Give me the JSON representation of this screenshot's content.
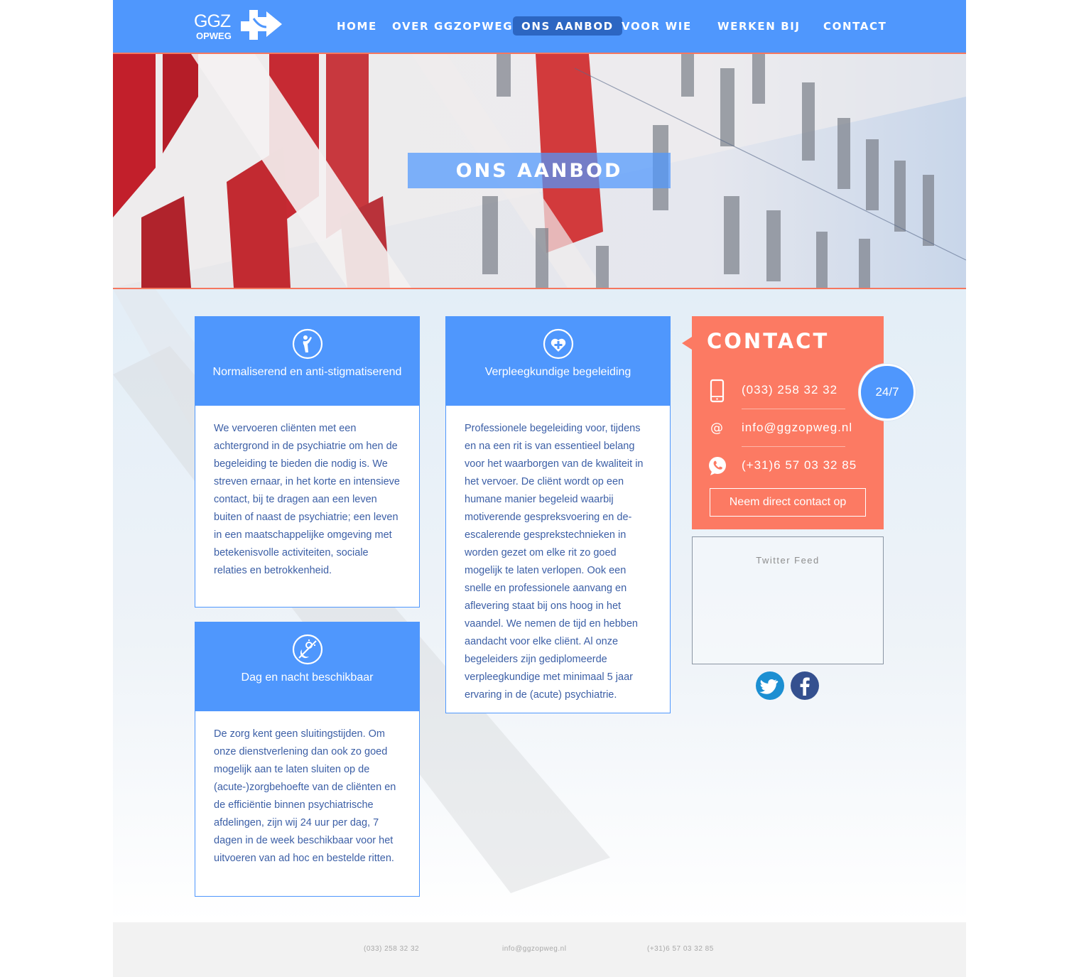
{
  "brand": {
    "logo_top": "GGZ",
    "logo_bottom": "OPWEG",
    "blue": "#4f97fd",
    "coral": "#fc7a63"
  },
  "nav": {
    "items": [
      {
        "label": "HOME",
        "active": false
      },
      {
        "label": "OVER GGZOPWEG",
        "active": false
      },
      {
        "label": "ONS AANBOD",
        "active": true
      },
      {
        "label": "VOOR WIE",
        "active": false
      },
      {
        "label": "WERKEN BIJ",
        "active": false
      },
      {
        "label": "CONTACT",
        "active": false
      }
    ]
  },
  "hero": {
    "title": "ONS AANBOD"
  },
  "cards": [
    {
      "icon": "person-icon",
      "title": "Normaliserend en anti-stigmatiserend",
      "body": "We vervoeren cliënten met een achtergrond in de psychiatrie om hen de begeleiding te bieden die nodig is. We streven ernaar, in het korte en intensieve contact, bij te dragen aan een leven buiten of naast de psychiatrie; een leven in een maatschappelijke omgeving met betekenisvolle activiteiten, sociale relaties en betrokkenheid."
    },
    {
      "icon": "heart-plus-icon",
      "title": "Verpleegkundige begeleiding",
      "body": "Professionele begeleiding voor, tijdens en na een rit is van essentieel belang voor het waarborgen van de kwaliteit in het vervoer. De cliënt wordt op een humane manier begeleid waarbij motiverende gespreksvoering en de-escalerende gesprekstechnieken in worden gezet om elke rit zo goed mogelijk te laten verlopen. Ook een snelle en professionele aanvang en aflevering staat bij ons hoog in het vaandel. We nemen de tijd en hebben aandacht voor elke cliënt.  Al onze begeleiders zijn gediplomeerde verpleegkundige met minimaal 5 jaar ervaring in de (acute) psychiatrie."
    },
    {
      "icon": "day-night-icon",
      "title": "Dag en nacht beschikbaar",
      "body": "De zorg kent geen sluitingstijden. Om onze dienstverlening dan ook zo goed mogelijk aan te laten sluiten op de (acute-)zorgbehoefte van de cliënten en de efficiëntie binnen psychiatrische afdelingen, zijn wij 24 uur per dag, 7 dagen in de week beschikbaar voor het uitvoeren van ad hoc en bestelde ritten."
    }
  ],
  "contact": {
    "title": "CONTACT",
    "phone": "(033) 258 32 32",
    "email": "info@ggzopweg.nl",
    "whatsapp": "(+31)6 57 03 32 85",
    "button": "Neem direct contact op",
    "badge": "24/7"
  },
  "twitter": {
    "label": "Twitter Feed"
  },
  "footer": {
    "phone": "(033) 258 32 32",
    "email": "info@ggzopweg.nl",
    "whatsapp": "(+31)6 57 03 32 85"
  }
}
